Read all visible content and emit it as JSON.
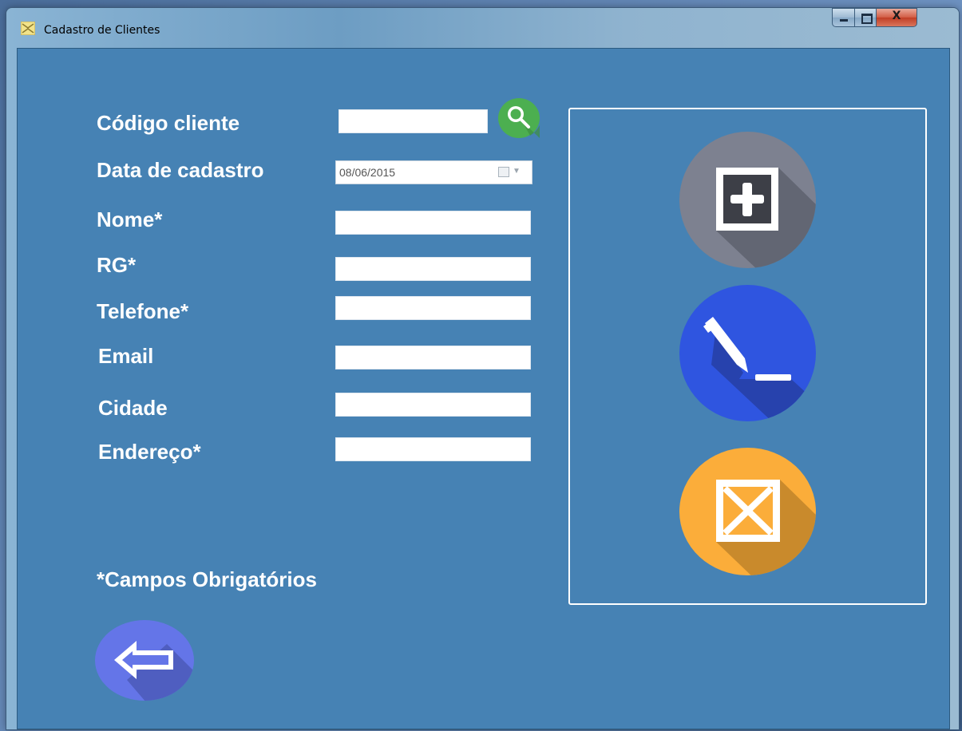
{
  "window": {
    "title": "Cadastro de Clientes",
    "close_glyph": "X"
  },
  "form": {
    "codigo_label": "Código cliente",
    "codigo_value": "",
    "data_label": "Data de cadastro",
    "data_value": "08/06/2015",
    "nome_label": "Nome*",
    "nome_value": "",
    "rg_label": "RG*",
    "rg_value": "",
    "telefone_label": "Telefone*",
    "telefone_value": "",
    "email_label": "Email",
    "email_value": "",
    "cidade_label": "Cidade",
    "cidade_value": "",
    "endereco_label": "Endereço*",
    "endereco_value": "",
    "required_note": "*Campos Obrigatórios"
  },
  "icons": {
    "search": "search-icon",
    "add": "add-icon",
    "edit": "edit-icon",
    "delete": "delete-icon",
    "back": "back-arrow-icon",
    "app": "app-icon"
  },
  "colors": {
    "client_bg": "#4682b4",
    "search_green": "#4caf50",
    "add_gray": "#7d8190",
    "edit_blue": "#2f55e0",
    "delete_orange": "#fbad3a",
    "back_purple": "#6475e8"
  }
}
